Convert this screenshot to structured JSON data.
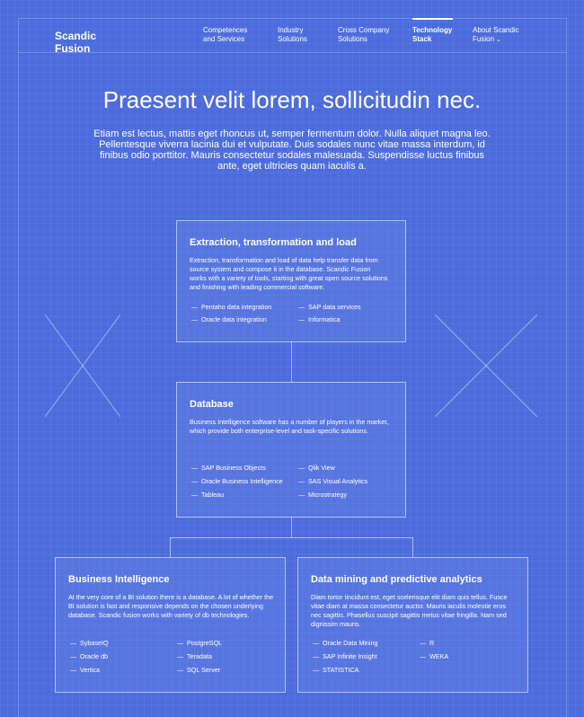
{
  "header": {
    "logo": "Scandic\nFusion",
    "nav": [
      {
        "label": "Competences and Services"
      },
      {
        "label": "Industry Solutions"
      },
      {
        "label": "Cross Company Solutions"
      },
      {
        "label": "Technology Stack"
      },
      {
        "label": "About Scandic Fusion"
      }
    ]
  },
  "hero": {
    "title": "Praesent velit lorem, sollicitudin nec.",
    "text": "Etiam est lectus, mattis eget rhoncus ut, semper fermentum dolor. Nulla aliquet magna leo. Pellentesque viverra lacinia dui et vulputate. Duis sodales nunc vitae massa interdum, id finibus odio porttitor. Mauris consectetur sodales malesuada. Suspendisse luctus finibus ante, eget ultricies quam iaculis a."
  },
  "cards": {
    "etl": {
      "title": "Extraction, transformation and load",
      "desc": "Extraction, transformation and load of data help transfer data from source system and compose it in the database. Scandic Fusion works with a variety of tools, starting with great open source solutions and finishing with leading commercial software.",
      "items": [
        "Pentaho data integration",
        "Oracle data integration",
        "SAP data services",
        "Informatica"
      ]
    },
    "db": {
      "title": "Database",
      "desc": "Business Intelligence software has a number of players in the market, which provide both enterprise-level and task-specific solutions.",
      "items": [
        "SAP Business Objects",
        "Oracle Business Intelligence",
        "Tableau",
        "Qlik View",
        "SAS Visual Analytics",
        "Microstrategy"
      ]
    },
    "bi": {
      "title": "Business Intelligence",
      "desc": "At the very core of a BI solution there is a database. A lot of whether the BI solution is fast and responsive depends on the chosen underlying database. Scandic fusion works with variety of db technologies.",
      "items": [
        "SybaseIQ",
        "Oracle db",
        "Vertica",
        "PostgreSQL",
        "Teradata",
        "SQL Server"
      ]
    },
    "dm": {
      "title": "Data mining and predictive analytics",
      "desc": "Diam tortor tincidunt est, eget scelerisque elit diam quis tellus. Fusce vitae diam at massa consectetur auctor. Mauris iaculis molestie eros nec sagittis. Phasellus suscipit sagittis metus vitae fringilla. Nam sed dignissim mauris.",
      "items": [
        "Oracle Data Mining",
        "SAP Infinite Insight",
        "STATISTICA",
        "R",
        "WEKA"
      ]
    }
  },
  "colors": {
    "background": "#4c6cdc",
    "text": "#ffffff"
  }
}
